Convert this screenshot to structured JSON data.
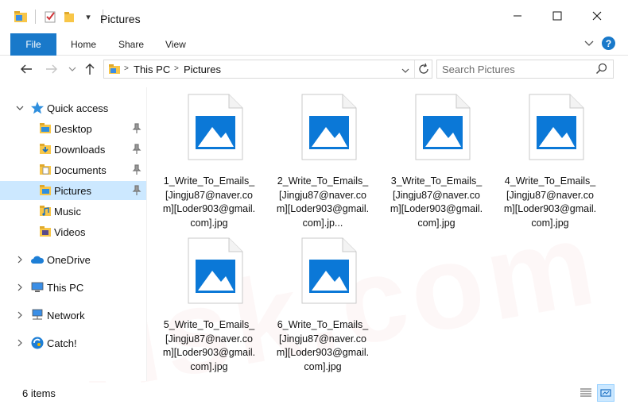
{
  "window": {
    "title": "Pictures"
  },
  "quick_access_toolbar": {
    "dropdown_glyph": "▾"
  },
  "window_controls": {
    "minimize": "—",
    "maximize": "☐",
    "close": "✕"
  },
  "ribbon": {
    "tabs": [
      {
        "label": "File"
      },
      {
        "label": "Home"
      },
      {
        "label": "Share"
      },
      {
        "label": "View"
      }
    ],
    "help_glyph": "?",
    "expand_glyph": "⌄"
  },
  "address": {
    "breadcrumbs": [
      "This PC",
      "Pictures"
    ],
    "separator": ">"
  },
  "search": {
    "placeholder": "Search Pictures"
  },
  "nav_pane": {
    "quick_access": "Quick access",
    "pinned": [
      {
        "label": "Desktop",
        "icon": "desktop-folder-icon"
      },
      {
        "label": "Downloads",
        "icon": "downloads-folder-icon"
      },
      {
        "label": "Documents",
        "icon": "documents-folder-icon"
      },
      {
        "label": "Pictures",
        "icon": "pictures-folder-icon"
      }
    ],
    "library": [
      {
        "label": "Music",
        "icon": "music-folder-icon"
      },
      {
        "label": "Videos",
        "icon": "videos-folder-icon"
      }
    ],
    "roots": [
      {
        "label": "OneDrive",
        "icon": "onedrive-icon"
      },
      {
        "label": "This PC",
        "icon": "this-pc-icon"
      },
      {
        "label": "Network",
        "icon": "network-icon"
      },
      {
        "label": "Catch!",
        "icon": "catch-icon"
      }
    ]
  },
  "files": [
    {
      "name": "1_Write_To_Emails_[Jingju87@naver.com][Loder903@gmail.com].jpg"
    },
    {
      "name": "2_Write_To_Emails_[Jingju87@naver.com][Loder903@gmail.com].jp..."
    },
    {
      "name": "3_Write_To_Emails_[Jingju87@naver.com][Loder903@gmail.com].jpg"
    },
    {
      "name": "4_Write_To_Emails_[Jingju87@naver.com][Loder903@gmail.com].jpg"
    },
    {
      "name": "5_Write_To_Emails_[Jingju87@naver.com][Loder903@gmail.com].jpg"
    },
    {
      "name": "6_Write_To_Emails_[Jingju87@naver.com][Loder903@gmail.com].jpg"
    }
  ],
  "status": {
    "item_count": "6 items"
  },
  "colors": {
    "accent": "#1979ca",
    "selection": "#cce8ff",
    "image_icon_blue": "#0b78d7",
    "folder_yellow": "#f8c648"
  }
}
